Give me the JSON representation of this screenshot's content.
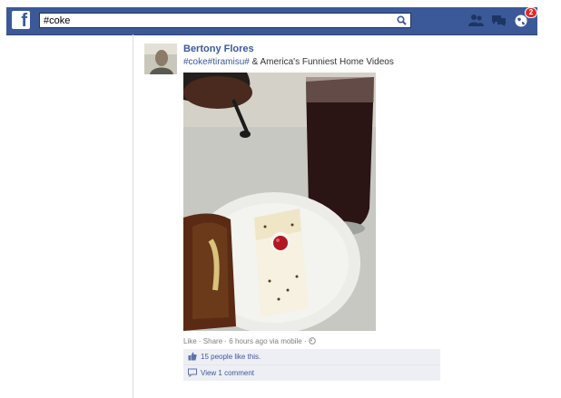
{
  "search": {
    "value": "#coke"
  },
  "header": {
    "logo_letter": "f",
    "notifications_badge": "2"
  },
  "post": {
    "author": "Bertony Flores",
    "caption_tags": "#coke#tiramisu#",
    "caption_rest": " & America's Funniest Home Videos",
    "meta": {
      "like": "Like",
      "sep1": " · ",
      "share": "Share",
      "sep2": " · ",
      "time": "6 hours ago via mobile",
      "sep3": " · "
    },
    "likes_text": "15 people like this.",
    "comments_text": "View 1 comment"
  },
  "colors": {
    "bar": "#3b5998",
    "link": "#3b5998",
    "badge": "#e02b2b"
  }
}
